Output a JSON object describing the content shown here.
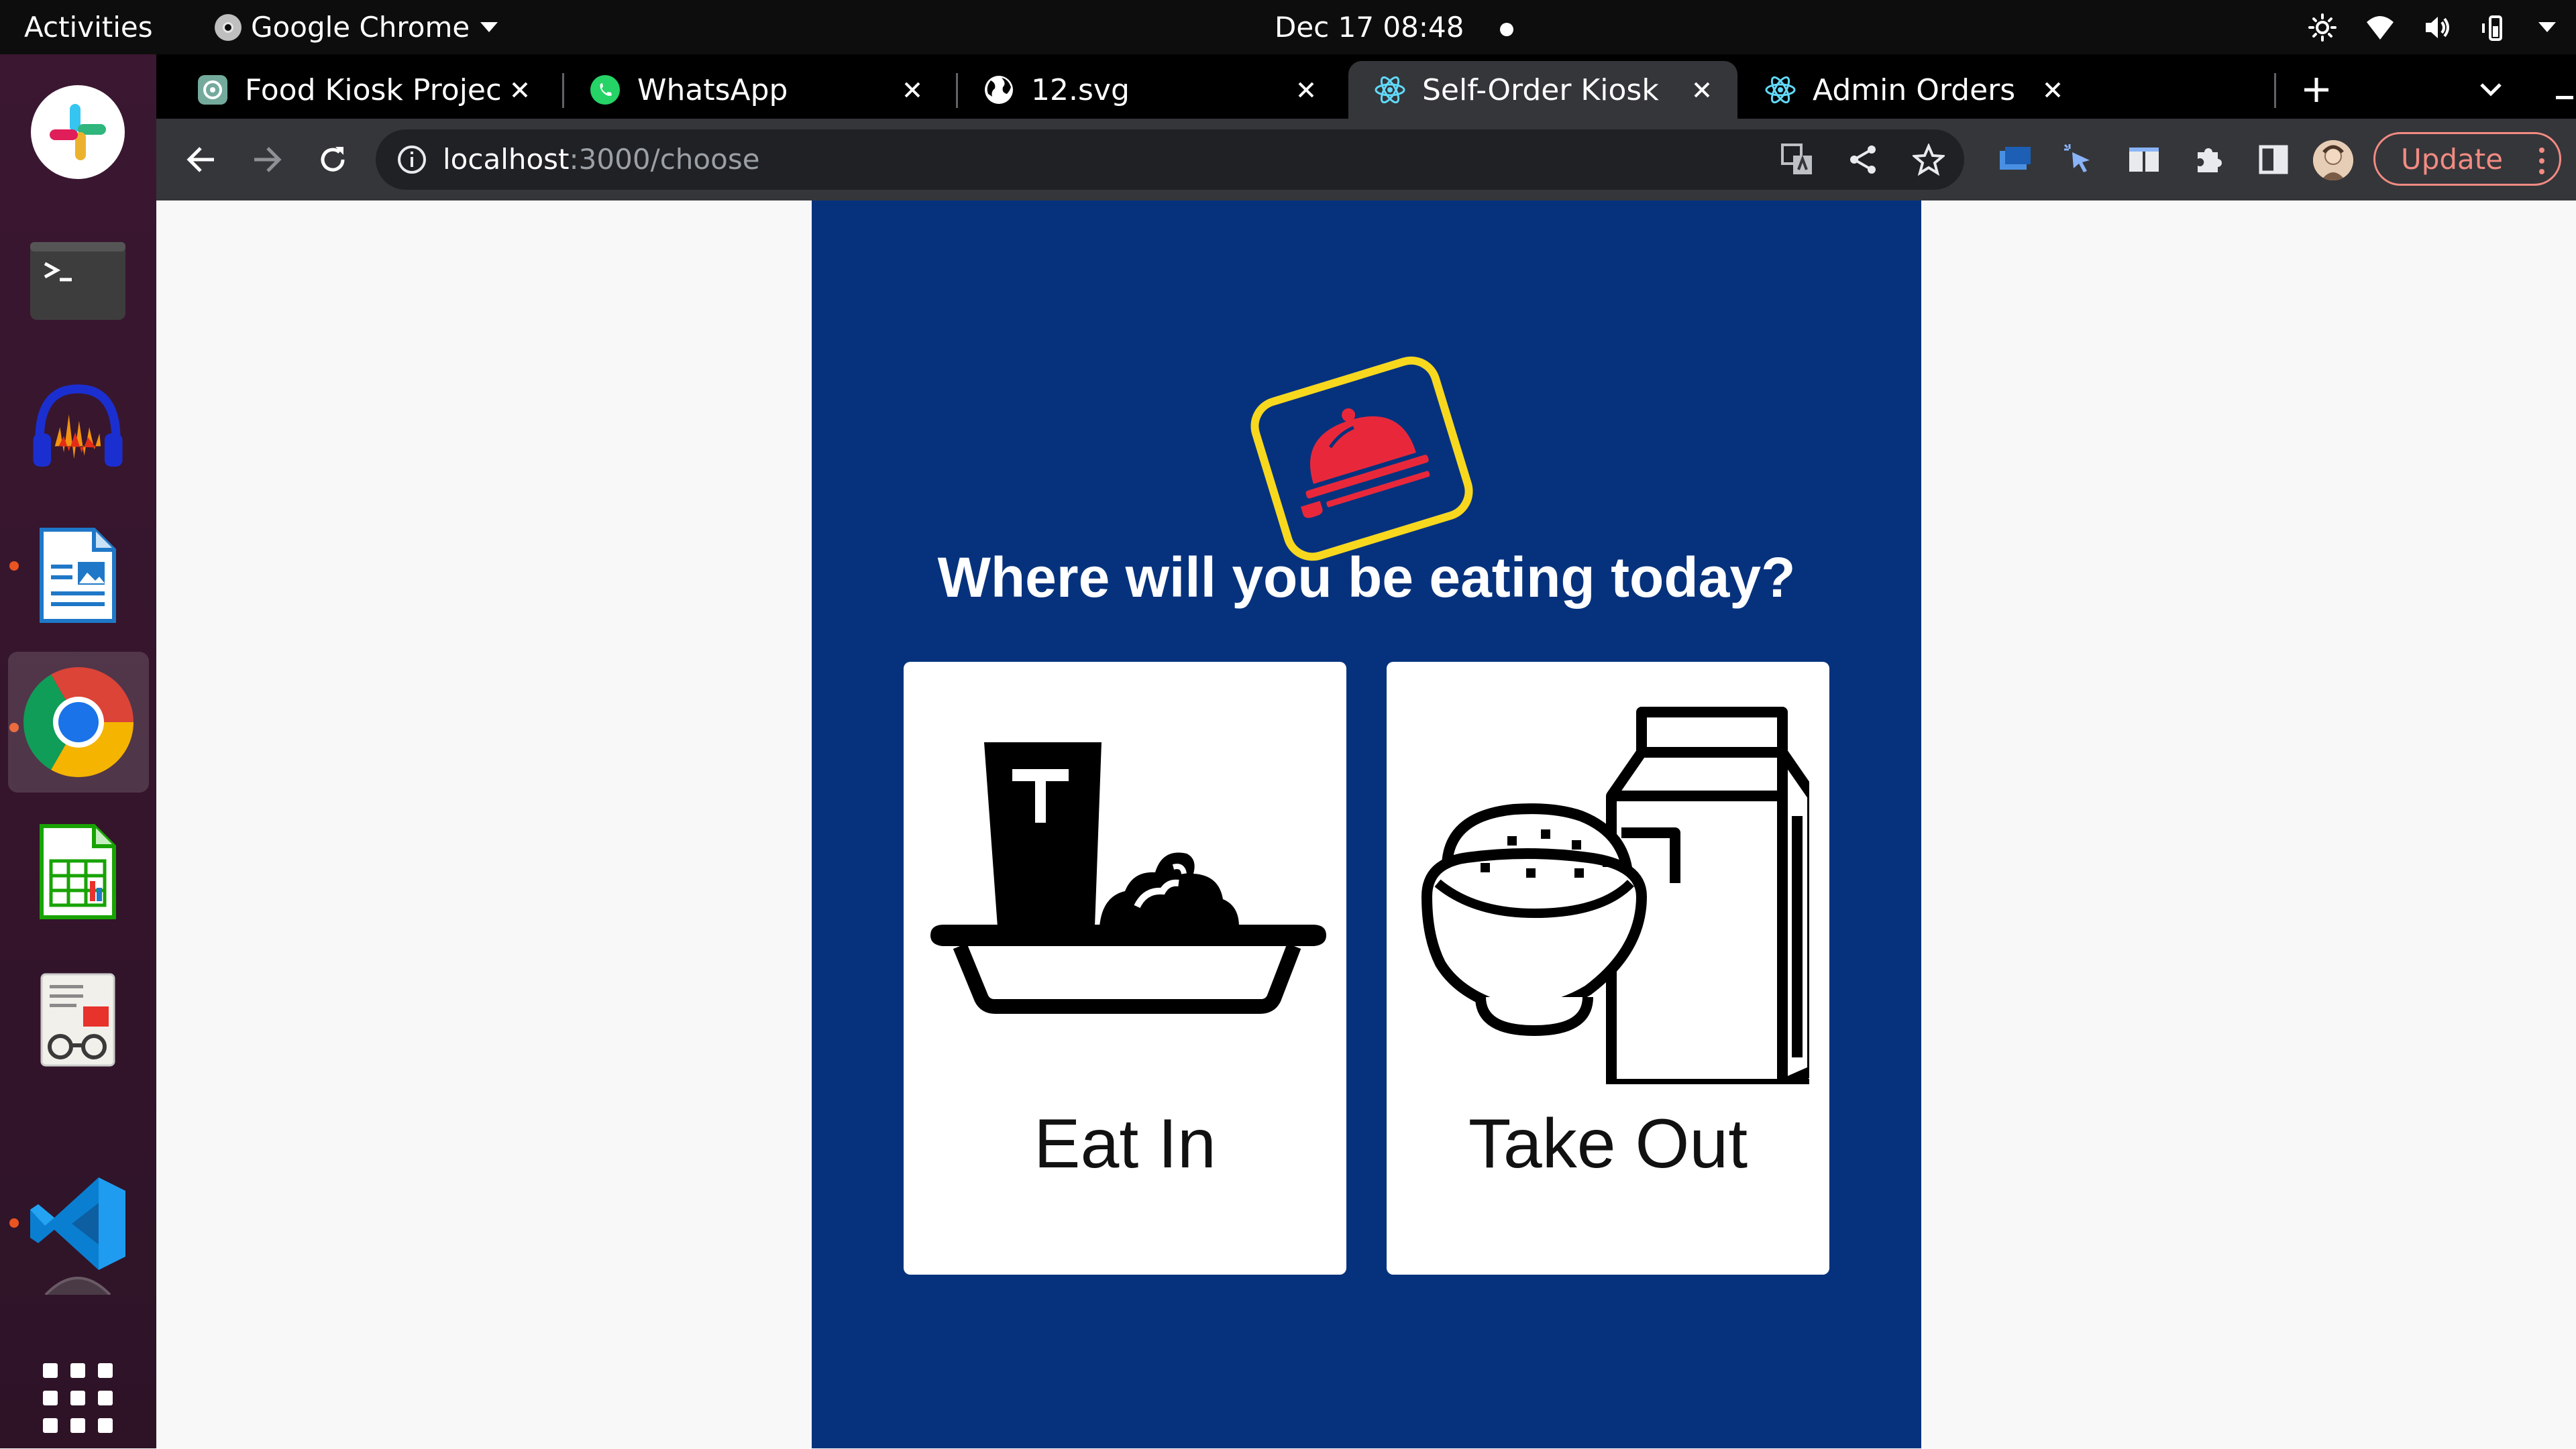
{
  "topbar": {
    "activities": "Activities",
    "app_name": "Google Chrome",
    "clock": "Dec 17  08:48"
  },
  "dock": {
    "apps": [
      "slack-icon",
      "terminal-icon",
      "audacity-icon",
      "libreoffice-draw-icon",
      "chrome-icon",
      "libreoffice-calc-icon",
      "document-viewer-icon",
      "vscode-icon",
      "show-apps-icon"
    ]
  },
  "tabs": [
    {
      "title": "Food Kiosk Project",
      "icon": "chatgpt-icon"
    },
    {
      "title": "WhatsApp",
      "icon": "whatsapp-icon"
    },
    {
      "title": "12.svg",
      "icon": "globe-icon"
    },
    {
      "title": "Self-Order Kiosk",
      "icon": "react-icon",
      "active": true
    },
    {
      "title": "Admin Orders",
      "icon": "react-icon"
    }
  ],
  "toolbar": {
    "url_host": "localhost",
    "url_path": ":3000/choose",
    "update_label": "Update"
  },
  "kiosk": {
    "question": "Where will you be eating today?",
    "options": [
      {
        "label": "Eat In",
        "icon": "tray-meal-icon"
      },
      {
        "label": "Take Out",
        "icon": "takeout-box-icon"
      }
    ]
  },
  "colors": {
    "kiosk_background": "#06327d",
    "logo_frame": "#f7d81e",
    "logo_cloche": "#e8283a",
    "update_accent": "#f28b82"
  }
}
